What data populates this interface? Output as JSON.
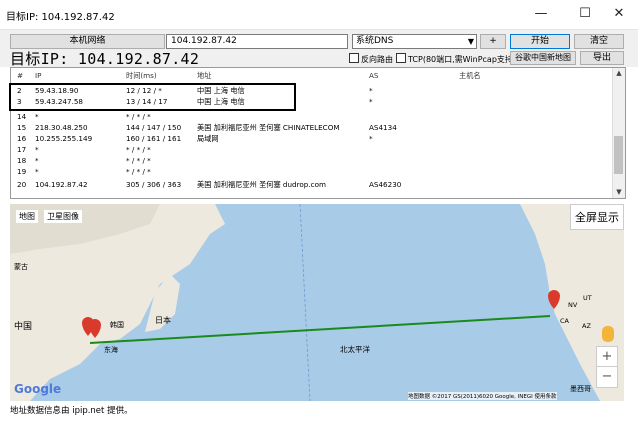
{
  "window": {
    "title": "目标IP: 104.192.87.42",
    "minimize": "—",
    "maximize": "☐",
    "close": "✕"
  },
  "toolbar": {
    "local_network_label": "本机网络",
    "target_input_value": "104.192.87.42",
    "dns_select_value": "系统DNS",
    "add_button": "+",
    "start_button": "开始",
    "clear_button": "清空",
    "reverse_route_label": "反向路由",
    "tcp_label": "TCP(80端口,需WinPcap支持)",
    "google_map_button": "谷歌中国新地图",
    "export_button": "导出"
  },
  "target_heading": "目标IP:  104.192.87.42",
  "table": {
    "headers": [
      "#",
      "IP",
      "时间(ms)",
      "地址",
      "AS",
      "主机名"
    ],
    "rows": [
      {
        "n": "2",
        "ip": "59.43.18.90",
        "time": "12 / 12 / *",
        "addr": "中国 上海 电信",
        "as": "*",
        "host": ""
      },
      {
        "n": "3",
        "ip": "59.43.247.58",
        "time": "13 / 14 / 17",
        "addr": "中国 上海 电信",
        "as": "*",
        "host": ""
      },
      {
        "n": "14",
        "ip": "*",
        "time": "* / * / *",
        "addr": "",
        "as": "",
        "host": ""
      },
      {
        "n": "15",
        "ip": "218.30.48.250",
        "time": "144 / 147 / 150",
        "addr": "美国 加利福尼亚州 圣何塞 CHINATELECOM",
        "as": "AS4134",
        "host": ""
      },
      {
        "n": "16",
        "ip": "10.255.255.149",
        "time": "160 / 161 / 161",
        "addr": "局域网",
        "as": "*",
        "host": ""
      },
      {
        "n": "17",
        "ip": "*",
        "time": "* / * / *",
        "addr": "",
        "as": "",
        "host": ""
      },
      {
        "n": "18",
        "ip": "*",
        "time": "* / * / *",
        "addr": "",
        "as": "",
        "host": ""
      },
      {
        "n": "19",
        "ip": "*",
        "time": "* / * / *",
        "addr": "",
        "as": "",
        "host": ""
      },
      {
        "n": "20",
        "ip": "104.192.87.42",
        "time": "305 / 306 / 363",
        "addr": "美国 加利福尼亚州 圣何塞 dudrop.com",
        "as": "AS46230",
        "host": ""
      }
    ]
  },
  "map": {
    "tab_map": "地图",
    "tab_satellite": "卫星图像",
    "fullscreen": "全屏显示",
    "labels": {
      "mongolia": "蒙古",
      "china": "中国",
      "korea": "韩国",
      "japan": "日本",
      "north_pacific": "北太平洋",
      "east_sea": "东海",
      "google": "Google",
      "ca": "CA",
      "nv": "NV",
      "ut": "UT",
      "az": "AZ",
      "mexico": "墨西哥"
    },
    "attribution": "地图数据 ©2017 GS(2011)6020 Google, INEGI  使用条款",
    "zoom_in": "+",
    "zoom_out": "−",
    "colors": {
      "ocean": "#a8cbe8",
      "land": "#eee9df",
      "route": "#1a8a1a",
      "marker": "#d93a2b"
    }
  },
  "status_text": "地址数据信息由 ipip.net 提供。"
}
